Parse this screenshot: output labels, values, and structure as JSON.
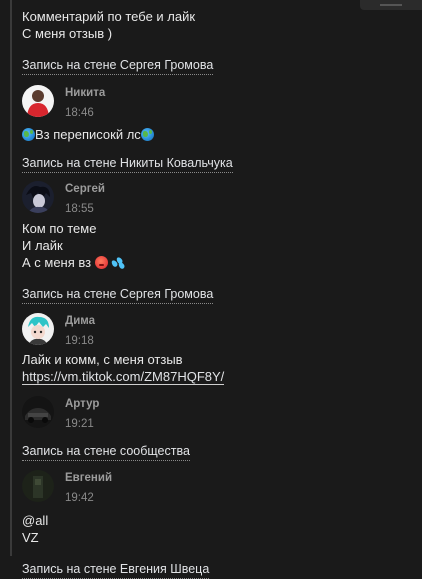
{
  "top_comment": {
    "line1": "Комментарий по тебе и лайк",
    "line2": "С меня отзыв )"
  },
  "posts": [
    {
      "wall_link": "Запись на стене Сергея Громова",
      "author": "Никита",
      "time": "18:46",
      "text_before": "Вз переписокй лс",
      "avatar_icon": "person-red-avatar"
    },
    {
      "wall_link": "Запись на стене Никиты Ковальчука",
      "author": "Сергей",
      "time": "18:55",
      "lines": [
        "Ком по теме",
        "И лайк",
        "А с меня вз"
      ],
      "avatar_icon": "anime-dark-avatar"
    },
    {
      "wall_link": "Запись на стене Сергея Громова",
      "author": "Дима",
      "time": "19:18",
      "line1": "Лайк и комм, с меня отзыв",
      "url": "https://vm.tiktok.com/ZM87HQF8Y/",
      "avatar_icon": "cyan-hair-avatar"
    },
    {
      "author": "Артур",
      "time": "19:21",
      "avatar_icon": "dark-car-avatar"
    },
    {
      "wall_link": "Запись на стене сообщества",
      "author": "Евгений",
      "time": "19:42",
      "lines": [
        "@all",
        "VZ"
      ],
      "avatar_icon": "dark-green-avatar"
    },
    {
      "wall_link": "Запись на стене Евгения Швеца"
    }
  ]
}
